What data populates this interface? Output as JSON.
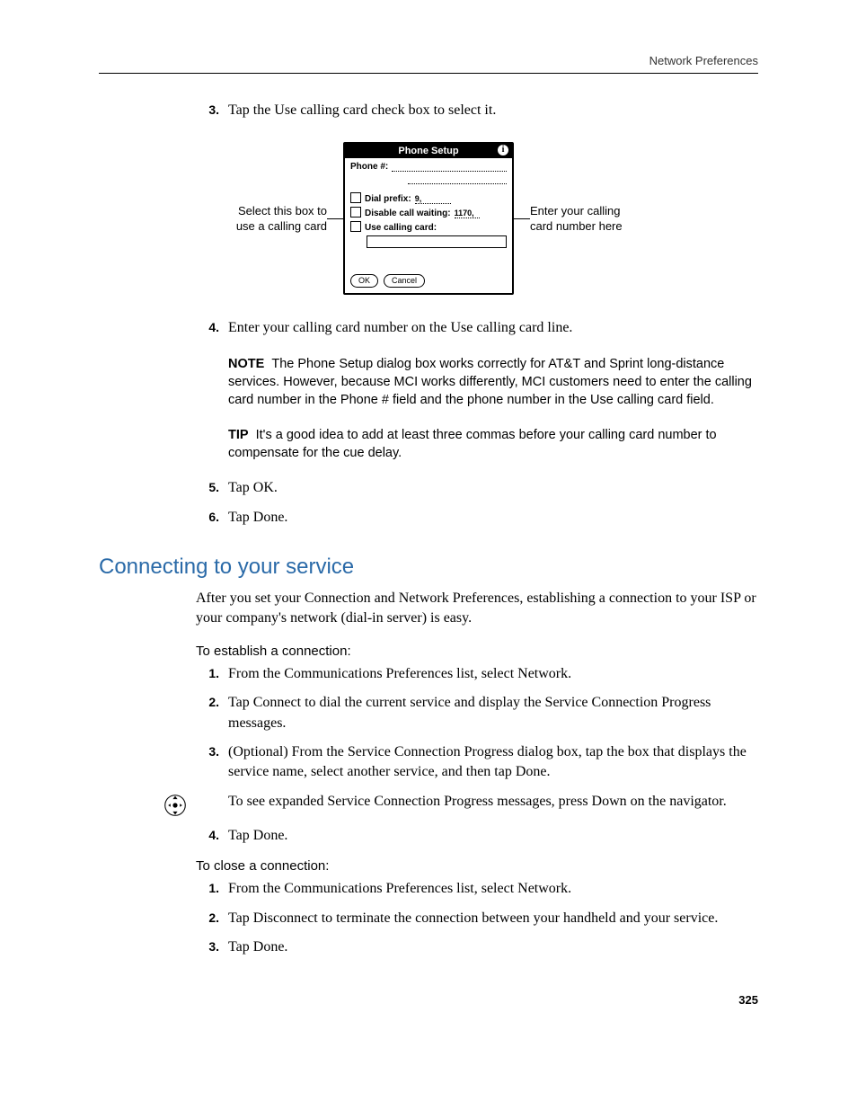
{
  "header": {
    "section": "Network Preferences"
  },
  "steps_a": [
    {
      "num": "3.",
      "text": "Tap the Use calling card check box to select it."
    }
  ],
  "figure": {
    "left_callout": "Select this box to use a calling card",
    "right_callout": "Enter your calling card number here",
    "dialog": {
      "title": "Phone Setup",
      "phone_label": "Phone #:",
      "dial_prefix_label": "Dial prefix:",
      "dial_prefix_value": "9,",
      "disable_cw_label": "Disable call waiting:",
      "disable_cw_value": "1170,",
      "use_card_label": "Use calling card:",
      "ok": "OK",
      "cancel": "Cancel"
    }
  },
  "steps_b": [
    {
      "num": "4.",
      "text": "Enter your calling card number on the Use calling card line."
    }
  ],
  "note": {
    "label": "NOTE",
    "text": "The Phone Setup dialog box works correctly for AT&T and Sprint long-distance services. However, because MCI works differently, MCI customers need to enter the calling card number in the Phone # field and the phone number in the Use calling card field."
  },
  "tip": {
    "label": "TIP",
    "text": "It's a good idea to add at least three commas before your calling card number to compensate for the cue delay."
  },
  "steps_c": [
    {
      "num": "5.",
      "text": "Tap OK."
    },
    {
      "num": "6.",
      "text": "Tap Done."
    }
  ],
  "section2": {
    "title": "Connecting to your service",
    "intro": "After you set your Connection and Network Preferences, establishing a connection to your ISP or your company's network (dial-in server) is easy."
  },
  "establish": {
    "head": "To establish a connection:",
    "steps": [
      {
        "num": "1.",
        "text": "From the Communications Preferences list, select Network."
      },
      {
        "num": "2.",
        "text": "Tap Connect to dial the current service and display the Service Connection Progress messages."
      },
      {
        "num": "3.",
        "text": "(Optional) From the Service Connection Progress dialog box, tap the box that displays the service name, select another service, and then tap Done."
      }
    ],
    "nav_text": "To see expanded Service Connection Progress messages, press Down on the navigator.",
    "steps_after": [
      {
        "num": "4.",
        "text": "Tap Done."
      }
    ]
  },
  "close": {
    "head": "To close a connection:",
    "steps": [
      {
        "num": "1.",
        "text": "From the Communications Preferences list, select Network."
      },
      {
        "num": "2.",
        "text": "Tap Disconnect to terminate the connection between your handheld and your service."
      },
      {
        "num": "3.",
        "text": "Tap Done."
      }
    ]
  },
  "page_number": "325"
}
